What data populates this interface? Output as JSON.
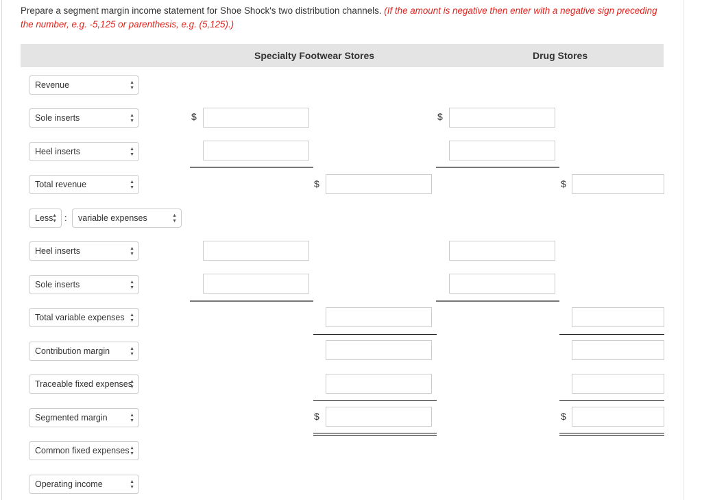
{
  "instructions": {
    "text": "Prepare a segment margin income statement for Shoe Shock's two distribution channels.",
    "warning": "(If the amount is negative then enter with a negative sign preceding the number, e.g. -5,125 or parenthesis, e.g. (5,125).)"
  },
  "header": {
    "col1": "Specialty Footwear Stores",
    "col2": "Drug Stores"
  },
  "currency_symbol": "$",
  "rows": [
    {
      "label": "Revenue"
    },
    {
      "label": "Sole inserts"
    },
    {
      "label": "Heel inserts"
    },
    {
      "label": "Total revenue"
    },
    {
      "prefix": "Less",
      "label": "variable expenses"
    },
    {
      "label": "Heel inserts"
    },
    {
      "label": "Sole inserts"
    },
    {
      "label": "Total variable expenses"
    },
    {
      "label": "Contribution margin"
    },
    {
      "label": "Traceable fixed expenses"
    },
    {
      "label": "Segmented margin"
    },
    {
      "label": "Common fixed expenses"
    },
    {
      "label": "Operating income"
    }
  ],
  "icons": {
    "select_arrow": "⬍"
  }
}
